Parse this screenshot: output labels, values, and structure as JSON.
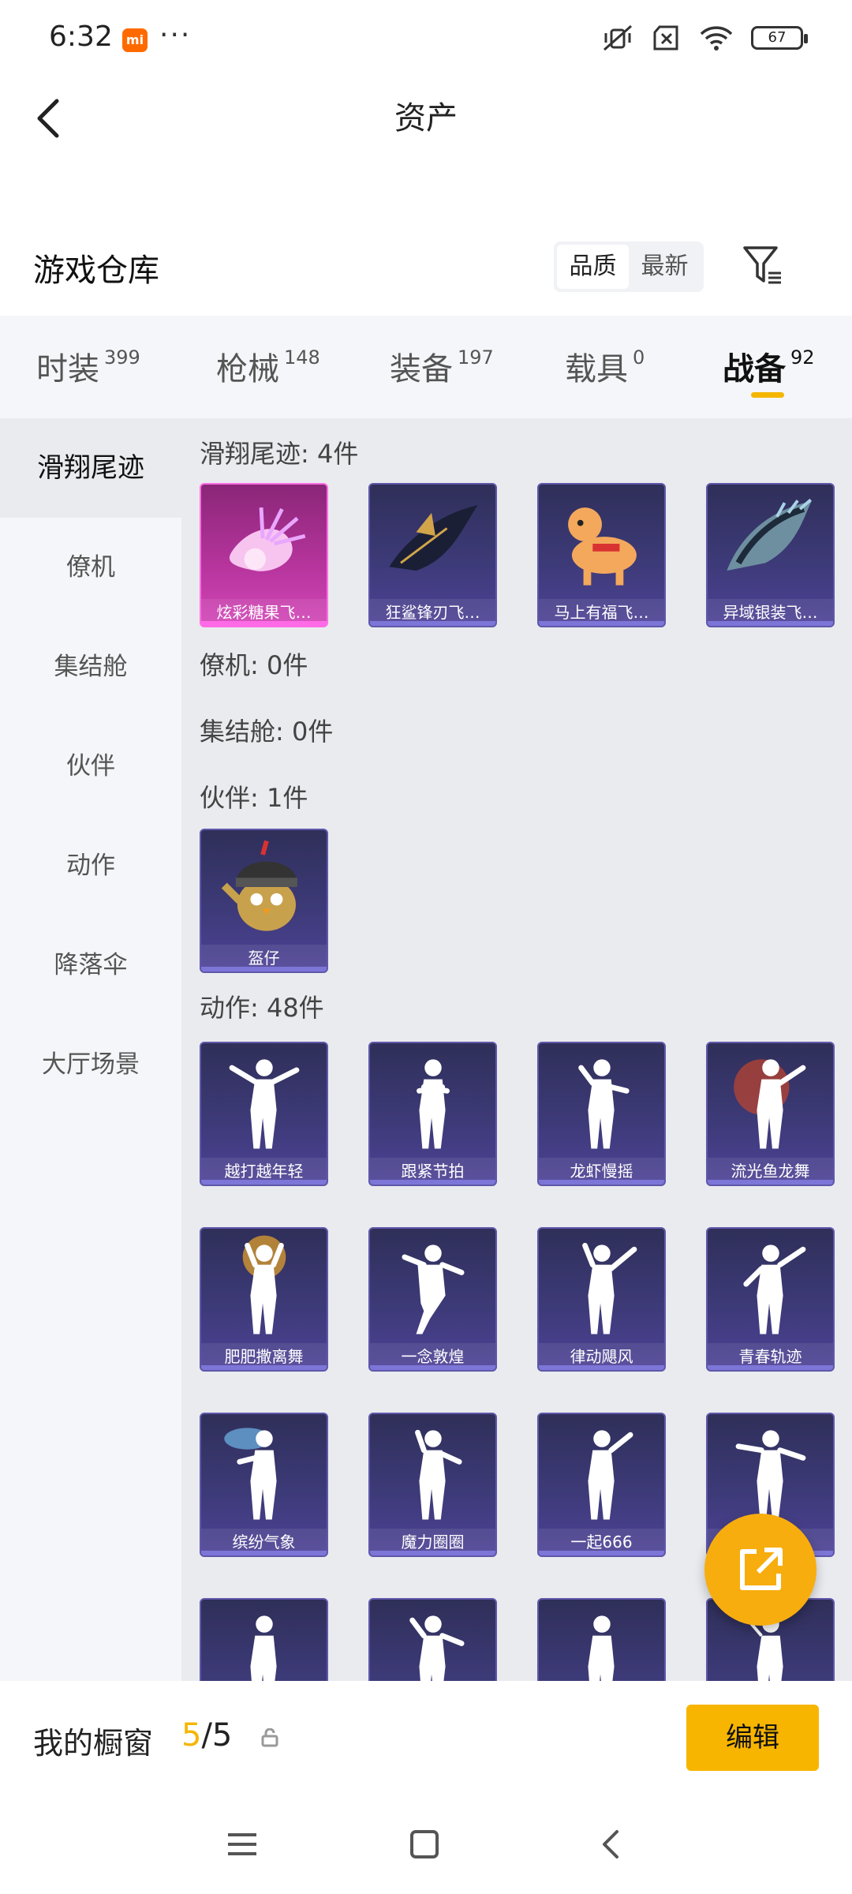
{
  "status_bar": {
    "time": "6:32",
    "mi_badge": "mi",
    "more": "···",
    "battery": "67",
    "icons": [
      "mute-vibrate-icon",
      "sim-off-icon",
      "wifi-icon",
      "battery-icon"
    ]
  },
  "header": {
    "title": "资产",
    "back_icon": "chevron-left-icon"
  },
  "warehouse": {
    "title": "游戏仓库",
    "sort_options": [
      "品质",
      "最新"
    ],
    "sort_selected": "品质",
    "filter_icon": "filter-icon"
  },
  "tabs": [
    {
      "label": "时装",
      "count": "399"
    },
    {
      "label": "枪械",
      "count": "148"
    },
    {
      "label": "装备",
      "count": "197"
    },
    {
      "label": "载具",
      "count": "0"
    },
    {
      "label": "战备",
      "count": "92",
      "active": true
    }
  ],
  "sidenav": [
    {
      "label": "滑翔尾迹",
      "active": true
    },
    {
      "label": "僚机"
    },
    {
      "label": "集结舱"
    },
    {
      "label": "伙伴"
    },
    {
      "label": "动作"
    },
    {
      "label": "降落伞"
    },
    {
      "label": "大厅场景"
    }
  ],
  "sections": {
    "glide": {
      "title": "滑翔尾迹: 4件",
      "items": [
        "炫彩糖果飞…",
        "狂鲨锋刃飞…",
        "马上有福飞…",
        "异域银装飞…"
      ]
    },
    "wingman": {
      "title": "僚机: 0件"
    },
    "capsule": {
      "title": "集结舱: 0件"
    },
    "partner": {
      "title": "伙伴: 1件",
      "items": [
        "盔仔"
      ]
    },
    "emote": {
      "title": "动作: 48件",
      "items": [
        "越打越年轻",
        "跟紧节拍",
        "龙虾慢摇",
        "流光鱼龙舞",
        "肥肥撒离舞",
        "一念敦煌",
        "律动飓风",
        "青春轨迹",
        "缤纷气象",
        "魔力圈圈",
        "一起666",
        "",
        "",
        "",
        "",
        ""
      ]
    }
  },
  "bottom": {
    "label": "我的橱窗",
    "current": "5",
    "total": "/5",
    "lock_icon": "lock-icon",
    "edit_label": "编辑"
  },
  "fab": {
    "icon": "share-icon"
  },
  "colors": {
    "accent": "#f7b500",
    "card": "#3d3a78",
    "card_highlight": "#b8359e"
  },
  "navbar": [
    "menu-icon",
    "home-icon",
    "back-icon"
  ]
}
